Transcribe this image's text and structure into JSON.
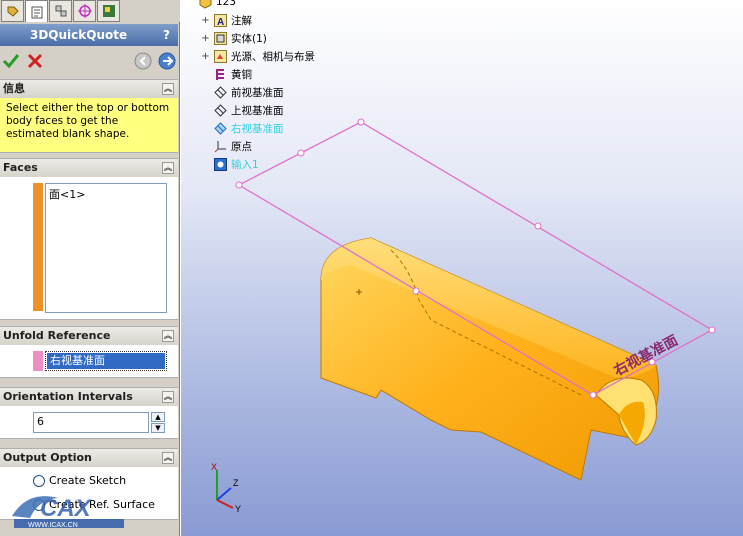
{
  "property_manager": {
    "title": "3DQuickQuote",
    "help": "?",
    "info": {
      "header": "信息",
      "text": "Select either the top or bottom body faces to get the estimated blank shape."
    },
    "faces": {
      "header": "Faces",
      "items": [
        "面<1>"
      ],
      "swatch_color": "#f0902a"
    },
    "unfold_reference": {
      "header": "Unfold Reference",
      "value": "右视基准面",
      "swatch_color": "#ee8ec6"
    },
    "orientation_intervals": {
      "header": "Orientation Intervals",
      "value": "6"
    },
    "output_option": {
      "header": "Output Option",
      "options": [
        "Create Sketch",
        "Create Ref. Surface"
      ]
    }
  },
  "feature_tree": {
    "root": "123",
    "items": [
      {
        "label": "注解",
        "expandable": true
      },
      {
        "label": "实体(1)",
        "expandable": true
      },
      {
        "label": "光源、相机与布景",
        "expandable": true
      },
      {
        "label": "黄铜",
        "expandable": false
      },
      {
        "label": "前视基准面",
        "expandable": false
      },
      {
        "label": "上视基准面",
        "expandable": false
      },
      {
        "label": "右视基准面",
        "expandable": false,
        "highlight": true
      },
      {
        "label": "原点",
        "expandable": false
      },
      {
        "label": "输入1",
        "expandable": false,
        "highlight": true
      }
    ]
  },
  "viewport": {
    "plane_label": "右视基准面",
    "watermark": "WWW.ICAX.CN",
    "axes": [
      "X",
      "Y",
      "Z"
    ]
  },
  "colors": {
    "highlight_text": "#2fd0e0",
    "plane_line": "#e070c8",
    "part_fill": "#ffb11c"
  }
}
